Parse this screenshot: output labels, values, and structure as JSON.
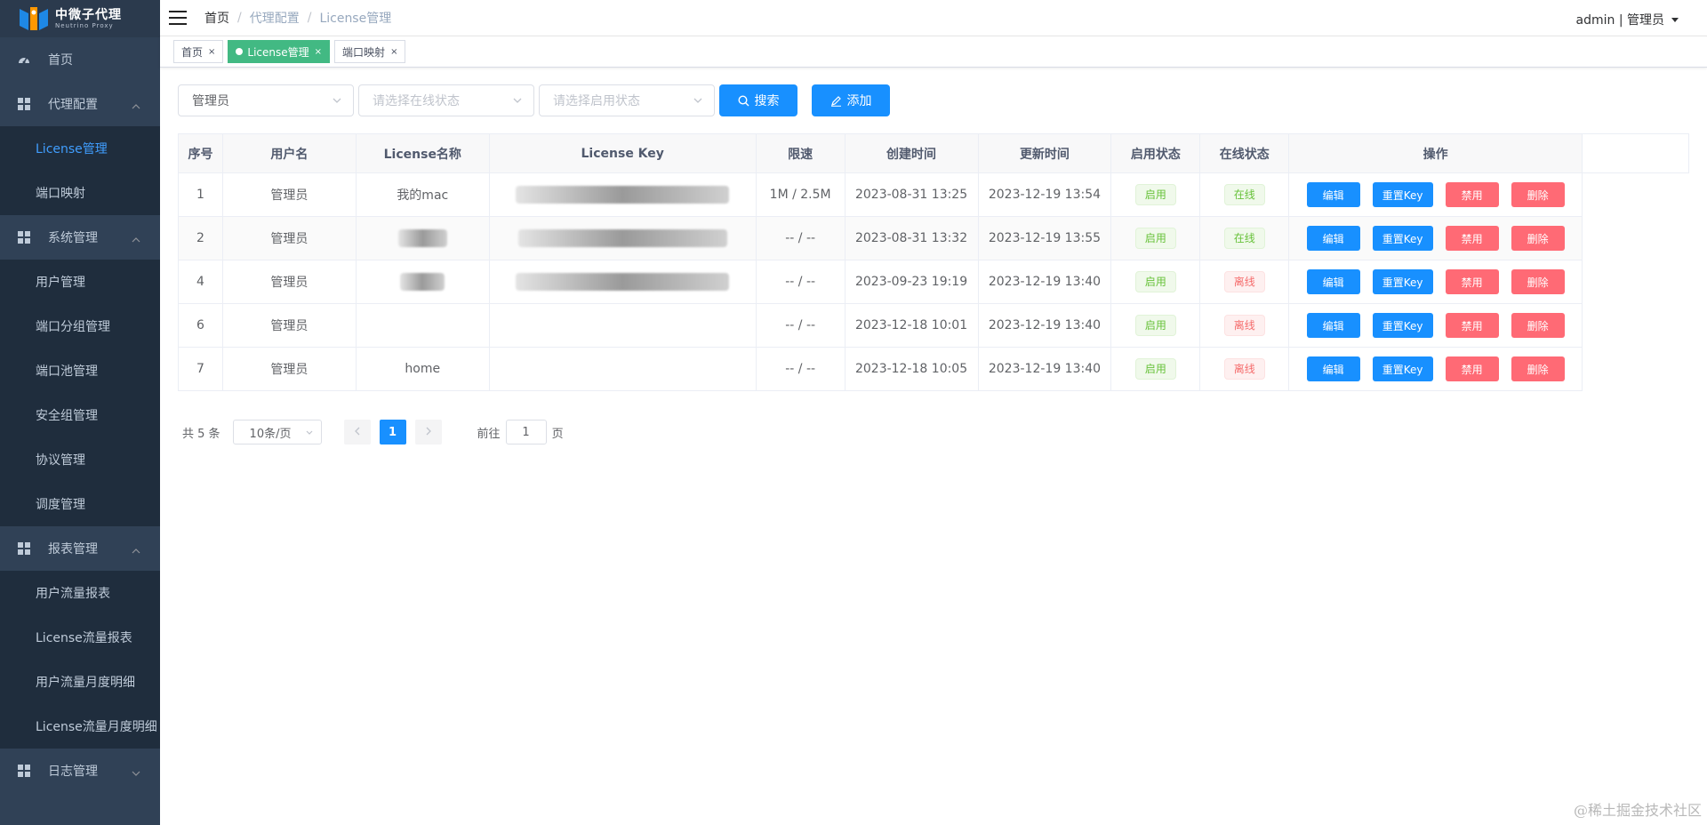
{
  "logo": {
    "title": "中微子代理",
    "subtitle": "Neutrino Proxy"
  },
  "sidebar": {
    "home": "首页",
    "groups": [
      {
        "label": "代理配置",
        "items": [
          "License管理",
          "端口映射"
        ]
      },
      {
        "label": "系统管理",
        "items": [
          "用户管理",
          "端口分组管理",
          "端口池管理",
          "安全组管理",
          "协议管理",
          "调度管理"
        ]
      },
      {
        "label": "报表管理",
        "items": [
          "用户流量报表",
          "License流量报表",
          "用户流量月度明细",
          "License流量月度明细"
        ]
      },
      {
        "label": "日志管理",
        "items": []
      }
    ],
    "active_item": "License管理"
  },
  "header": {
    "breadcrumb": [
      "首页",
      "代理配置",
      "License管理"
    ],
    "separator": "/",
    "user": "admin | 管理员"
  },
  "tags": [
    {
      "label": "首页",
      "active": false
    },
    {
      "label": "License管理",
      "active": true
    },
    {
      "label": "端口映射",
      "active": false
    }
  ],
  "tag_close": "×",
  "filters": {
    "user_value": "管理员",
    "online_placeholder": "请选择在线状态",
    "enable_placeholder": "请选择启用状态",
    "search_label": "搜索",
    "add_label": "添加"
  },
  "table": {
    "columns": [
      "序号",
      "用户名",
      "License名称",
      "License Key",
      "限速",
      "创建时间",
      "更新时间",
      "启用状态",
      "在线状态",
      "操作"
    ],
    "rows": [
      {
        "id": "1",
        "user": "管理员",
        "name": "我的mac",
        "speed": "1M / 2.5M",
        "created": "2023-08-31 13:25",
        "updated": "2023-12-19 13:54",
        "enabled": "启用",
        "online": "在线",
        "online_ok": true
      },
      {
        "id": "2",
        "user": "管理员",
        "name": "",
        "speed": "-- / --",
        "created": "2023-08-31 13:32",
        "updated": "2023-12-19 13:55",
        "enabled": "启用",
        "online": "在线",
        "online_ok": true
      },
      {
        "id": "4",
        "user": "管理员",
        "name": "",
        "speed": "-- / --",
        "created": "2023-09-23 19:19",
        "updated": "2023-12-19 13:40",
        "enabled": "启用",
        "online": "离线",
        "online_ok": false
      },
      {
        "id": "6",
        "user": "管理员",
        "name": "",
        "speed": "-- / --",
        "created": "2023-12-18 10:01",
        "updated": "2023-12-19 13:40",
        "enabled": "启用",
        "online": "离线",
        "online_ok": false
      },
      {
        "id": "7",
        "user": "管理员",
        "name": "home",
        "speed": "-- / --",
        "created": "2023-12-18 10:05",
        "updated": "2023-12-19 13:40",
        "enabled": "启用",
        "online": "离线",
        "online_ok": false
      }
    ],
    "actions": {
      "edit": "编辑",
      "reset": "重置Key",
      "disable": "禁用",
      "delete": "删除"
    }
  },
  "pagination": {
    "total": "共 5 条",
    "page_size": "10条/页",
    "current_page": "1",
    "goto_prefix": "前往",
    "goto_value": "1",
    "goto_suffix": "页"
  },
  "watermark": "@稀土掘金技术社区",
  "colors": {
    "sidebar_bg": "#304156",
    "accent": "#1890ff",
    "danger": "#ff6a75",
    "tag_active": "#42b983"
  }
}
